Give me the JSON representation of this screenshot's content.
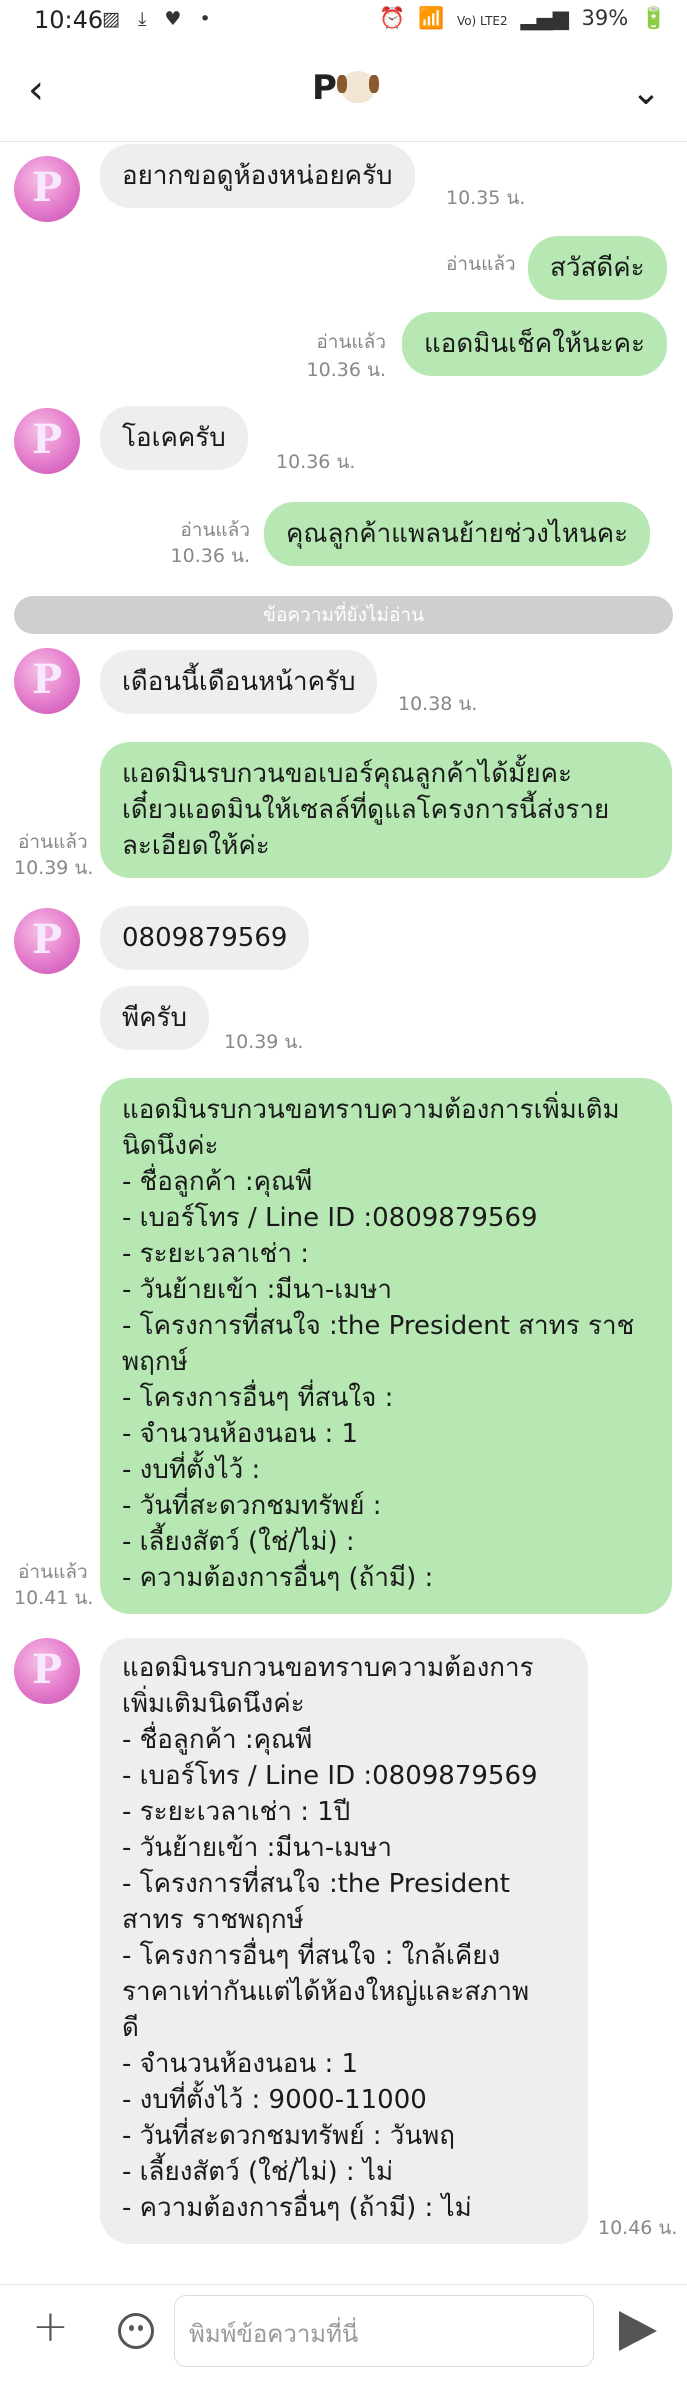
{
  "status_bar": {
    "time": "10:46",
    "left_icons": "▨ ⤓ ♥ •",
    "right_icons": [
      "⏰",
      "📶",
      "Vo) LTE2",
      "▂▄▆",
      "39%",
      "🔋"
    ]
  },
  "header": {
    "back_icon": "‹",
    "title": "P",
    "dropdown_icon": "⌄"
  },
  "avatar_letter": "P",
  "messages": {
    "m1": {
      "text": "อยากขอดูห้องหน่อยครับ",
      "time": "10.35 น."
    },
    "m2": {
      "text": "สวัสดีค่ะ",
      "read": "อ่านแล้ว"
    },
    "m3": {
      "text": "แอดมินเช็คให้นะคะ",
      "read": "อ่านแล้ว",
      "time": "10.36 น."
    },
    "m4": {
      "text": "โอเคครับ",
      "time": "10.36 น."
    },
    "m5": {
      "text": "คุณลูกค้าแพลนย้ายช่วงไหนคะ",
      "read": "อ่านแล้ว",
      "time": "10.36 น."
    },
    "divider": "ข้อความที่ยังไม่อ่าน",
    "m6": {
      "text": "เดือนนี้เดือนหน้าครับ",
      "time": "10.38 น."
    },
    "m7": {
      "lines": [
        "แอดมินรบกวนขอเบอร์คุณลูกค้าได้มั้ยคะ",
        "เดี๋ยวแอดมินให้เซลล์ที่ดูแลโครงการนี้ส่งราย",
        "ละเอียดให้ค่ะ"
      ],
      "read": "อ่านแล้ว",
      "time": "10.39 น."
    },
    "m8": {
      "text": "0809879569"
    },
    "m9": {
      "text": "พีครับ",
      "time": "10.39 น."
    },
    "m10": {
      "lines": [
        "แอดมินรบกวนขอทราบความต้องการเพิ่มเติม",
        "นิดนึงค่ะ",
        "- ชื่อลูกค้า :คุณพี",
        "- เบอร์โทร / Line ID :0809879569",
        "- ระยะเวลาเช่า :",
        "- วันย้ายเข้า :มีนา-เมษา",
        "- โครงการที่สนใจ :the President สาทร ราช",
        "พฤกษ์",
        "- โครงการอื่นๆ ที่สนใจ :",
        "- จำนวนห้องนอน : 1",
        "- งบที่ตั้งไว้ :",
        "- วันที่สะดวกชมทรัพย์ :",
        "- เลี้ยงสัตว์ (ใช่/ไม่) :",
        "- ความต้องการอื่นๆ (ถ้ามี) :"
      ],
      "read": "อ่านแล้ว",
      "time": "10.41 น."
    },
    "m11": {
      "lines": [
        "แอดมินรบกวนขอทราบความต้องการ",
        "เพิ่มเติมนิดนึงค่ะ",
        "- ชื่อลูกค้า :คุณพี",
        "- เบอร์โทร / Line ID :0809879569",
        "- ระยะเวลาเช่า : 1ปี",
        "- วันย้ายเข้า :มีนา-เมษา",
        "- โครงการที่สนใจ :the President",
        "สาทร ราชพฤกษ์",
        "- โครงการอื่นๆ ที่สนใจ : ใกล้เคียง",
        "ราคาเท่ากันแต่ได้ห้องใหญ่และสภาพ",
        "ดี",
        "- จำนวนห้องนอน : 1",
        "- งบที่ตั้งไว้ : 9000-11000",
        "- วันที่สะดวกชมทรัพย์ : วันพฤ",
        "- เลี้ยงสัตว์ (ใช่/ไม่) : ไม่",
        "- ความต้องการอื่นๆ (ถ้ามี) : ไม่"
      ],
      "time": "10.46 น."
    }
  },
  "composer": {
    "placeholder": "พิมพ์ข้อความที่นี่",
    "plus_icon": "+",
    "emoji_icon": "smiley-icon",
    "send_icon": "send-icon"
  }
}
